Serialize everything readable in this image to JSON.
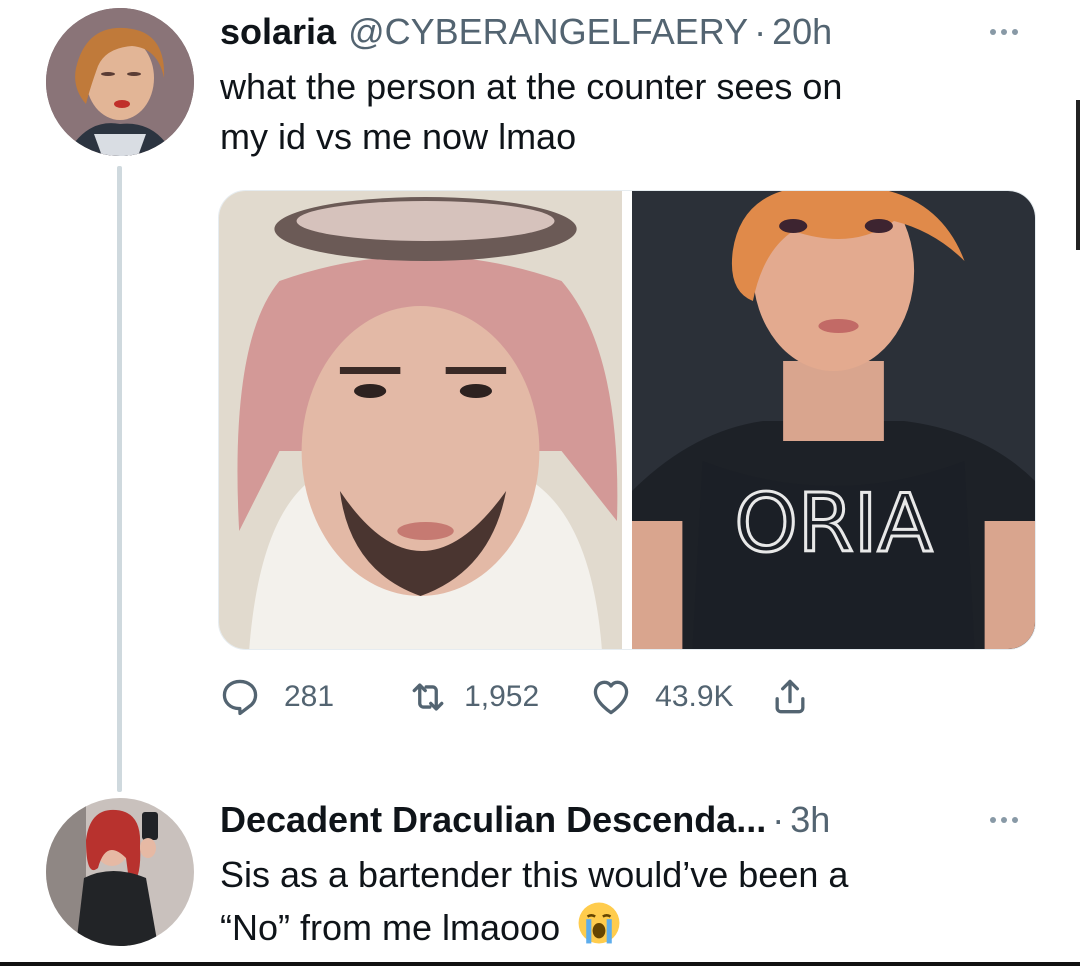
{
  "tweet1": {
    "name": "solaria",
    "handle": "@CYBERANGELFAERY",
    "separator": "·",
    "time": "20h",
    "text_line1": "what the person at the counter sees on",
    "text_line2": "my id vs me now lmao",
    "actions": {
      "reply_count": "281",
      "retweet_count": "1,952",
      "like_count": "43.9K"
    }
  },
  "tweet2": {
    "name": "Decadent Draculian Descenda...",
    "separator": "·",
    "time": "3h",
    "text_line1": "Sis as a bartender this would’ve been a",
    "text_line2": "“No” from me lmaooo"
  },
  "icons": {
    "reply": "reply-icon",
    "retweet": "retweet-icon",
    "like": "heart-icon",
    "share": "share-icon",
    "more": "more-icon",
    "emoji": "loudly-crying-face-emoji"
  },
  "colors": {
    "text": "#0f1419",
    "secondary": "#536471",
    "thread_line": "#cfd9de",
    "background": "#ffffff"
  }
}
